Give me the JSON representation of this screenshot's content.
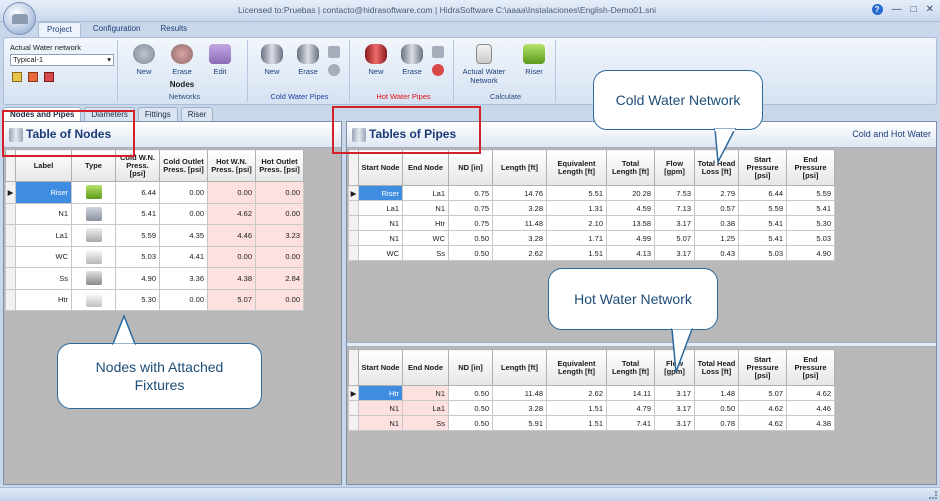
{
  "window": {
    "title": "Licensed to:Pruebas | contacto@hidrasoftware.com | HidraSoftware   C:\\aaaa\\Instalaciones\\English-Demo01.sni"
  },
  "menu_tabs": [
    "Project",
    "Configuration",
    "Results"
  ],
  "ribbon": {
    "network_label": "Actual Water network",
    "network_value": "Typical-1",
    "networks": {
      "label": "Networks",
      "new": "New",
      "erase": "Erase",
      "edit": "Edit",
      "nodes": "Nodes"
    },
    "cold": {
      "label": "Cold Water Pipes",
      "new": "New",
      "erase": "Erase"
    },
    "hot": {
      "label": "Hot Water Pipes",
      "new": "New",
      "erase": "Erase"
    },
    "calc": {
      "label": "Calculate",
      "actual": "Actual Water Network",
      "riser": "Riser"
    }
  },
  "doc_tabs": [
    "Nodes and Pipes",
    "Diameters",
    "Fittings",
    "Riser"
  ],
  "nodes_panel": {
    "title": "Table of Nodes",
    "headers": [
      "Label",
      "Type",
      "Cold W.N. Press. [psi]",
      "Cold Outlet Press. [psi]",
      "Hot W.N. Press. [psi]",
      "Hot Outlet Press. [psi]"
    ],
    "rows": [
      {
        "label": "Riser",
        "type": "riser-icon",
        "c1": "6.44",
        "c2": "0.00",
        "h1": "0.00",
        "h2": "0.00"
      },
      {
        "label": "N1",
        "type": "tee-icon",
        "c1": "5.41",
        "c2": "0.00",
        "h1": "4.62",
        "h2": "0.00"
      },
      {
        "label": "La1",
        "type": "lavatory-icon",
        "c1": "5.59",
        "c2": "4.35",
        "h1": "4.46",
        "h2": "3.23"
      },
      {
        "label": "WC",
        "type": "toilet-icon",
        "c1": "5.03",
        "c2": "4.41",
        "h1": "0.00",
        "h2": "0.00"
      },
      {
        "label": "Ss",
        "type": "sink-icon",
        "c1": "4.90",
        "c2": "3.36",
        "h1": "4.38",
        "h2": "2.84"
      },
      {
        "label": "Htr",
        "type": "heater-icon",
        "c1": "5.30",
        "c2": "0.00",
        "h1": "5.07",
        "h2": "0.00"
      }
    ]
  },
  "pipes_panel": {
    "title": "Tables of Pipes",
    "subtitle": "Cold and Hot Water",
    "headers": [
      "Start Node",
      "End Node",
      "ND [in]",
      "Length [ft]",
      "Equivalent Length [ft]",
      "Total Length [ft]",
      "Flow [gpm]",
      "Total Head Loss [ft]",
      "Start Pressure [psi]",
      "End Pressure [psi]"
    ],
    "cold_rows": [
      [
        "Riser",
        "La1",
        "0.75",
        "14.76",
        "5.51",
        "20.28",
        "7.53",
        "2.79",
        "6.44",
        "5.59"
      ],
      [
        "La1",
        "N1",
        "0.75",
        "3.28",
        "1.31",
        "4.59",
        "7.13",
        "0.57",
        "5.59",
        "5.41"
      ],
      [
        "N1",
        "Htr",
        "0.75",
        "11.48",
        "2.10",
        "13.58",
        "3.17",
        "0.38",
        "5.41",
        "5.30"
      ],
      [
        "N1",
        "WC",
        "0.50",
        "3.28",
        "1.71",
        "4.99",
        "5.07",
        "1.25",
        "5.41",
        "5.03"
      ],
      [
        "WC",
        "Ss",
        "0.50",
        "2.62",
        "1.51",
        "4.13",
        "3.17",
        "0.43",
        "5.03",
        "4.90"
      ]
    ],
    "hot_rows": [
      [
        "Htr",
        "N1",
        "0.50",
        "11.48",
        "2.62",
        "14.11",
        "3.17",
        "1.48",
        "5.07",
        "4.62"
      ],
      [
        "N1",
        "La1",
        "0.50",
        "3.28",
        "1.51",
        "4.79",
        "3.17",
        "0.50",
        "4.62",
        "4.46"
      ],
      [
        "N1",
        "Ss",
        "0.50",
        "5.91",
        "1.51",
        "7.41",
        "3.17",
        "0.78",
        "4.62",
        "4.38"
      ]
    ]
  },
  "callouts": {
    "cold": "Cold Water Network",
    "hot": "Hot Water Network",
    "nodes": "Nodes with Attached Fixtures"
  },
  "colors": {
    "selected": "#3f8de0",
    "hot_tint": "#fde1e1",
    "callout_border": "#2c6a9e",
    "highlight": "#d4202a"
  }
}
